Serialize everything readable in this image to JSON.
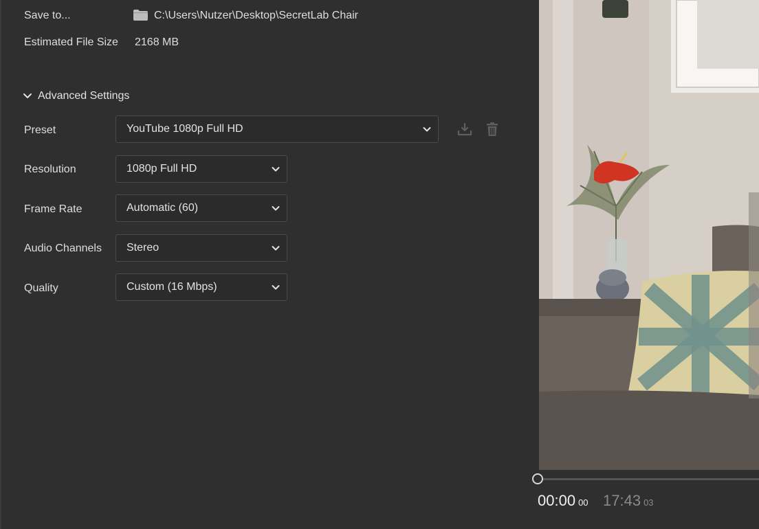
{
  "save_to": {
    "label": "Save to...",
    "path": "C:\\Users\\Nutzer\\Desktop\\SecretLab Chair",
    "icon": "folder-icon"
  },
  "file_size": {
    "label": "Estimated File Size",
    "value": "2168 MB"
  },
  "advanced": {
    "title": "Advanced Settings",
    "expanded": true,
    "preset": {
      "label": "Preset",
      "value": "YouTube 1080p Full HD"
    },
    "resolution": {
      "label": "Resolution",
      "value": "1080p Full HD"
    },
    "frame_rate": {
      "label": "Frame Rate",
      "value": "Automatic (60)"
    },
    "audio_channels": {
      "label": "Audio Channels",
      "value": "Stereo"
    },
    "quality": {
      "label": "Quality",
      "value": "Custom (16 Mbps)"
    }
  },
  "playback": {
    "current_time": "00:00",
    "current_frames": "00",
    "total_time": "17:43",
    "total_frames": "03",
    "progress": 0
  },
  "colors": {
    "background": "#2f2f2f",
    "text": "#e3e3e3",
    "muted_text": "#8a8a8a"
  }
}
